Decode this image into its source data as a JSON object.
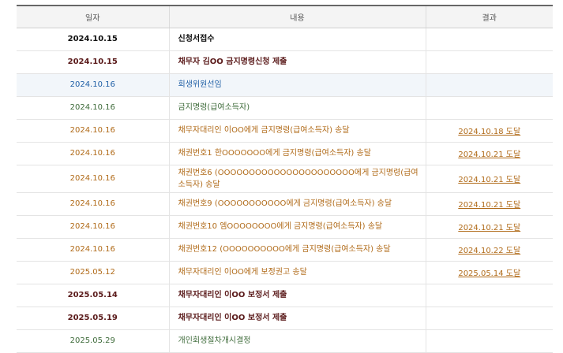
{
  "header": {
    "date": "일자",
    "content": "내용",
    "result": "결과"
  },
  "rows": [
    {
      "date": "2024.10.15",
      "content": "신청서접수",
      "result": "",
      "style": "c-black bold"
    },
    {
      "date": "2024.10.15",
      "content": "채무자 김OO 금지명령신청 제출",
      "result": "",
      "style": "c-maroon bold"
    },
    {
      "date": "2024.10.16",
      "content": "회생위원선임",
      "result": "",
      "style": "c-blue",
      "highlight": true
    },
    {
      "date": "2024.10.16",
      "content": "금지명령(급여소득자)",
      "result": "",
      "style": "c-green"
    },
    {
      "date": "2024.10.16",
      "content": "채무자대리인 이OO에게 금지명령(급여소득자) 송달",
      "result": "2024.10.18 도달",
      "style": "c-orange"
    },
    {
      "date": "2024.10.16",
      "content": "채권번호1 한OOOOOOO에게 금지명령(급여소득자) 송달",
      "result": "2024.10.21 도달",
      "style": "c-orange"
    },
    {
      "date": "2024.10.16",
      "content": "채권번호6 (OOOOOOOOOOOOOOOOOOOOOO에게 금지명령(급여소득자) 송달",
      "result": "2024.10.21 도달",
      "style": "c-orange",
      "tall": true
    },
    {
      "date": "2024.10.16",
      "content": "채권번호9 (OOOOOOOOOOO에게 금지명령(급여소득자) 송달",
      "result": "2024.10.21 도달",
      "style": "c-orange"
    },
    {
      "date": "2024.10.16",
      "content": "채권번호10 엠OOOOOOOO에게 금지명령(급여소득자) 송달",
      "result": "2024.10.21 도달",
      "style": "c-orange"
    },
    {
      "date": "2024.10.16",
      "content": "채권번호12 (OOOOOOOOOO에게 금지명령(급여소득자) 송달",
      "result": "2024.10.22 도달",
      "style": "c-orange"
    },
    {
      "date": "2025.05.12",
      "content": "채무자대리인 이OO에게 보정권고 송달",
      "result": "2025.05.14 도달",
      "style": "c-orange"
    },
    {
      "date": "2025.05.14",
      "content": "채무자대리인 이OO 보정서 제출",
      "result": "",
      "style": "c-maroon bold"
    },
    {
      "date": "2025.05.19",
      "content": "채무자대리인 이OO 보정서 제출",
      "result": "",
      "style": "c-maroon bold"
    },
    {
      "date": "2025.05.29",
      "content": "개인회생절차개시결정",
      "result": "",
      "style": "c-green"
    }
  ]
}
